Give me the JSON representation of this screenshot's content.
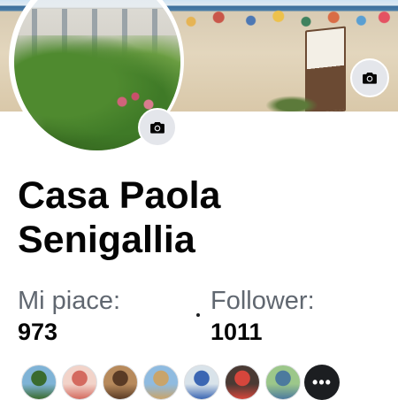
{
  "page": {
    "name": "Casa Paola Senigallia"
  },
  "stats": {
    "likes_label": "Mi piace:",
    "likes_value": "973",
    "followers_label": "Follower:",
    "followers_value": "1011",
    "separator": "·"
  },
  "icons": {
    "cover_camera": "camera-icon",
    "profile_camera": "camera-icon",
    "more": "more-horizontal-icon"
  },
  "friends": {
    "more_label": "•••",
    "avatars": [
      {
        "name": "friend-avatar-1",
        "colors": [
          "#7fb3d6",
          "#3a6b2e"
        ]
      },
      {
        "name": "friend-avatar-2",
        "colors": [
          "#f2d3c9",
          "#d46a5f"
        ]
      },
      {
        "name": "friend-avatar-3",
        "colors": [
          "#b78a5c",
          "#5a3b25"
        ]
      },
      {
        "name": "friend-avatar-4",
        "colors": [
          "#8fbbe0",
          "#c9a46a"
        ]
      },
      {
        "name": "friend-avatar-5",
        "colors": [
          "#d9e3ea",
          "#3b66b3"
        ]
      },
      {
        "name": "friend-avatar-6",
        "colors": [
          "#4a3a34",
          "#d6463c"
        ]
      },
      {
        "name": "friend-avatar-7",
        "colors": [
          "#9cc78a",
          "#4c7a9e"
        ]
      }
    ]
  },
  "colors": {
    "camera_button_bg": "#e4e6eb",
    "name_text": "#050505",
    "label_text": "#606770"
  }
}
